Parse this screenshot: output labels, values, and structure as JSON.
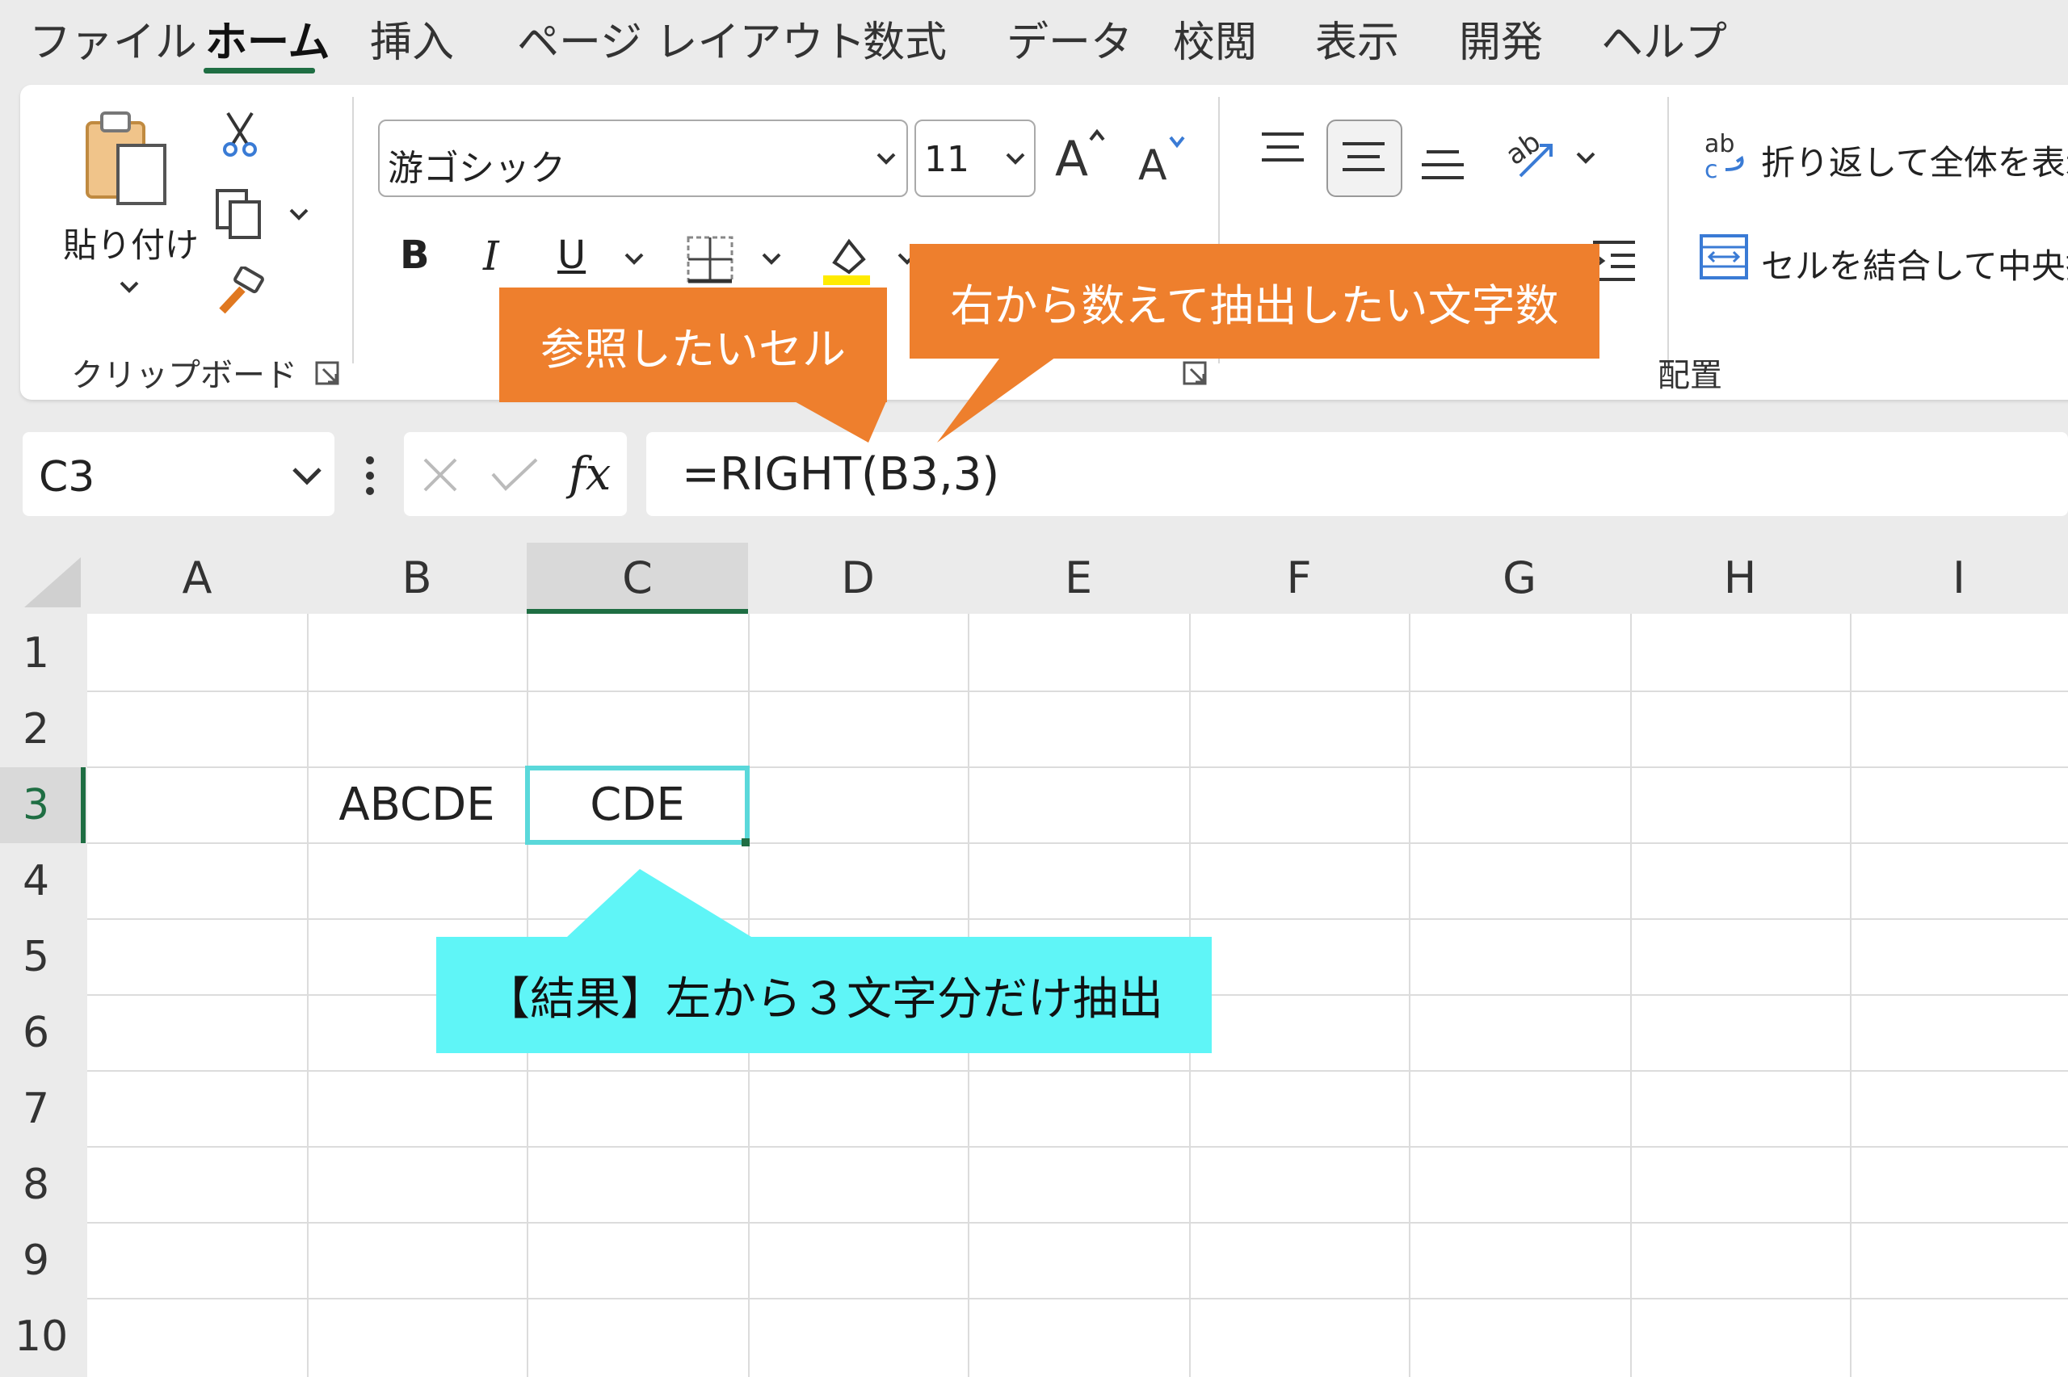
{
  "menu": {
    "tabs": [
      "ファイル",
      "ホーム",
      "挿入",
      "ページ レイアウト",
      "数式",
      "データ",
      "校閲",
      "表示",
      "開発",
      "ヘルプ"
    ],
    "active": "ホーム"
  },
  "clipboard": {
    "paste_label": "貼り付け",
    "group_label": "クリップボード"
  },
  "font": {
    "name": "游ゴシック",
    "size": "11",
    "bold": "B",
    "italic": "I",
    "underline": "U"
  },
  "alignment": {
    "wrap_text": "折り返して全体を表示",
    "merge_center": "セルを結合して中央揃え",
    "group_label": "配置"
  },
  "formula_bar": {
    "name_box": "C3",
    "fx": "fx",
    "formula": "=RIGHT(B3,3)"
  },
  "grid": {
    "columns": [
      "A",
      "B",
      "C",
      "D",
      "E",
      "F",
      "G",
      "H",
      "I"
    ],
    "rows": [
      "1",
      "2",
      "3",
      "4",
      "5",
      "6",
      "7",
      "8",
      "9",
      "10"
    ],
    "selected_cell": "C3",
    "cells": {
      "B3": "ABCDE",
      "C3": "CDE"
    }
  },
  "callouts": {
    "ref_cell": "参照したいセル",
    "num_chars": "右から数えて抽出したい文字数",
    "result": "【結果】左から３文字分だけ抽出"
  },
  "colors": {
    "accent_green": "#1f6e43",
    "callout_orange": "#ee7f2d",
    "callout_cyan": "#5ff5f7",
    "selection": "#5ad8da"
  }
}
